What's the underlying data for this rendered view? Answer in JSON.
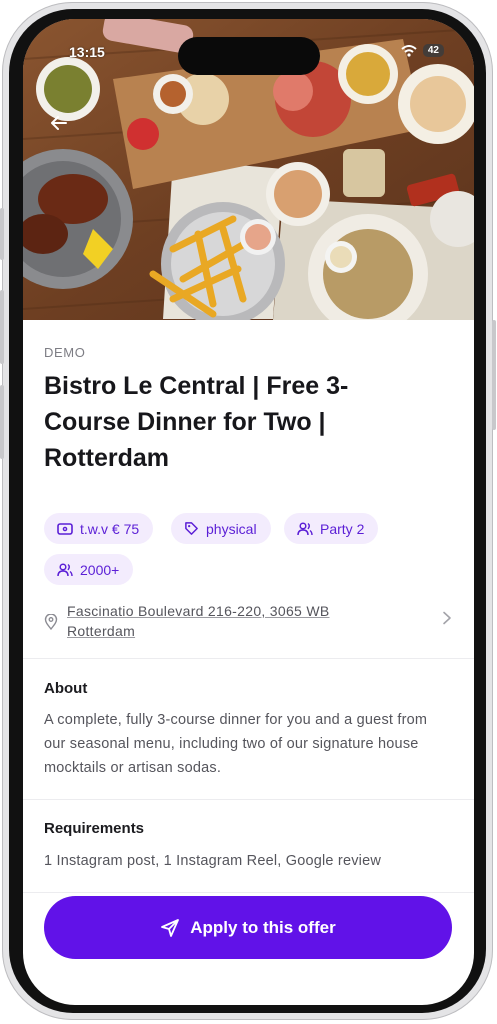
{
  "status_bar": {
    "time": "13:15",
    "battery": "42"
  },
  "hero": {
    "image_description_icon": "food-table-photo"
  },
  "offer": {
    "category": "DEMO",
    "title": "Bistro Le Central | Free 3-Course Dinner for Two | Rotterdam",
    "chips": [
      {
        "icon": "ticket-icon",
        "label": "t.w.v € 75"
      },
      {
        "icon": "tag-icon",
        "label": "physical"
      },
      {
        "icon": "people-icon",
        "label": "Party 2"
      },
      {
        "icon": "people-icon",
        "label": "2000+"
      }
    ],
    "address": "Fascinatio Boulevard 216-220, 3065 WB Rotterdam"
  },
  "about": {
    "title": "About",
    "text": "A complete, fully  3-course dinner for you and a guest from our seasonal menu, including two of our signature house mocktails or artisan sodas."
  },
  "requirements": {
    "title": "Requirements",
    "text": "1 Instagram post, 1 Instagram Reel, Google review"
  },
  "cta": {
    "label": "Apply to this offer"
  },
  "colors": {
    "accent": "#6112e8",
    "chip_bg": "#f3ecfd",
    "chip_text": "#5b1fd6"
  }
}
